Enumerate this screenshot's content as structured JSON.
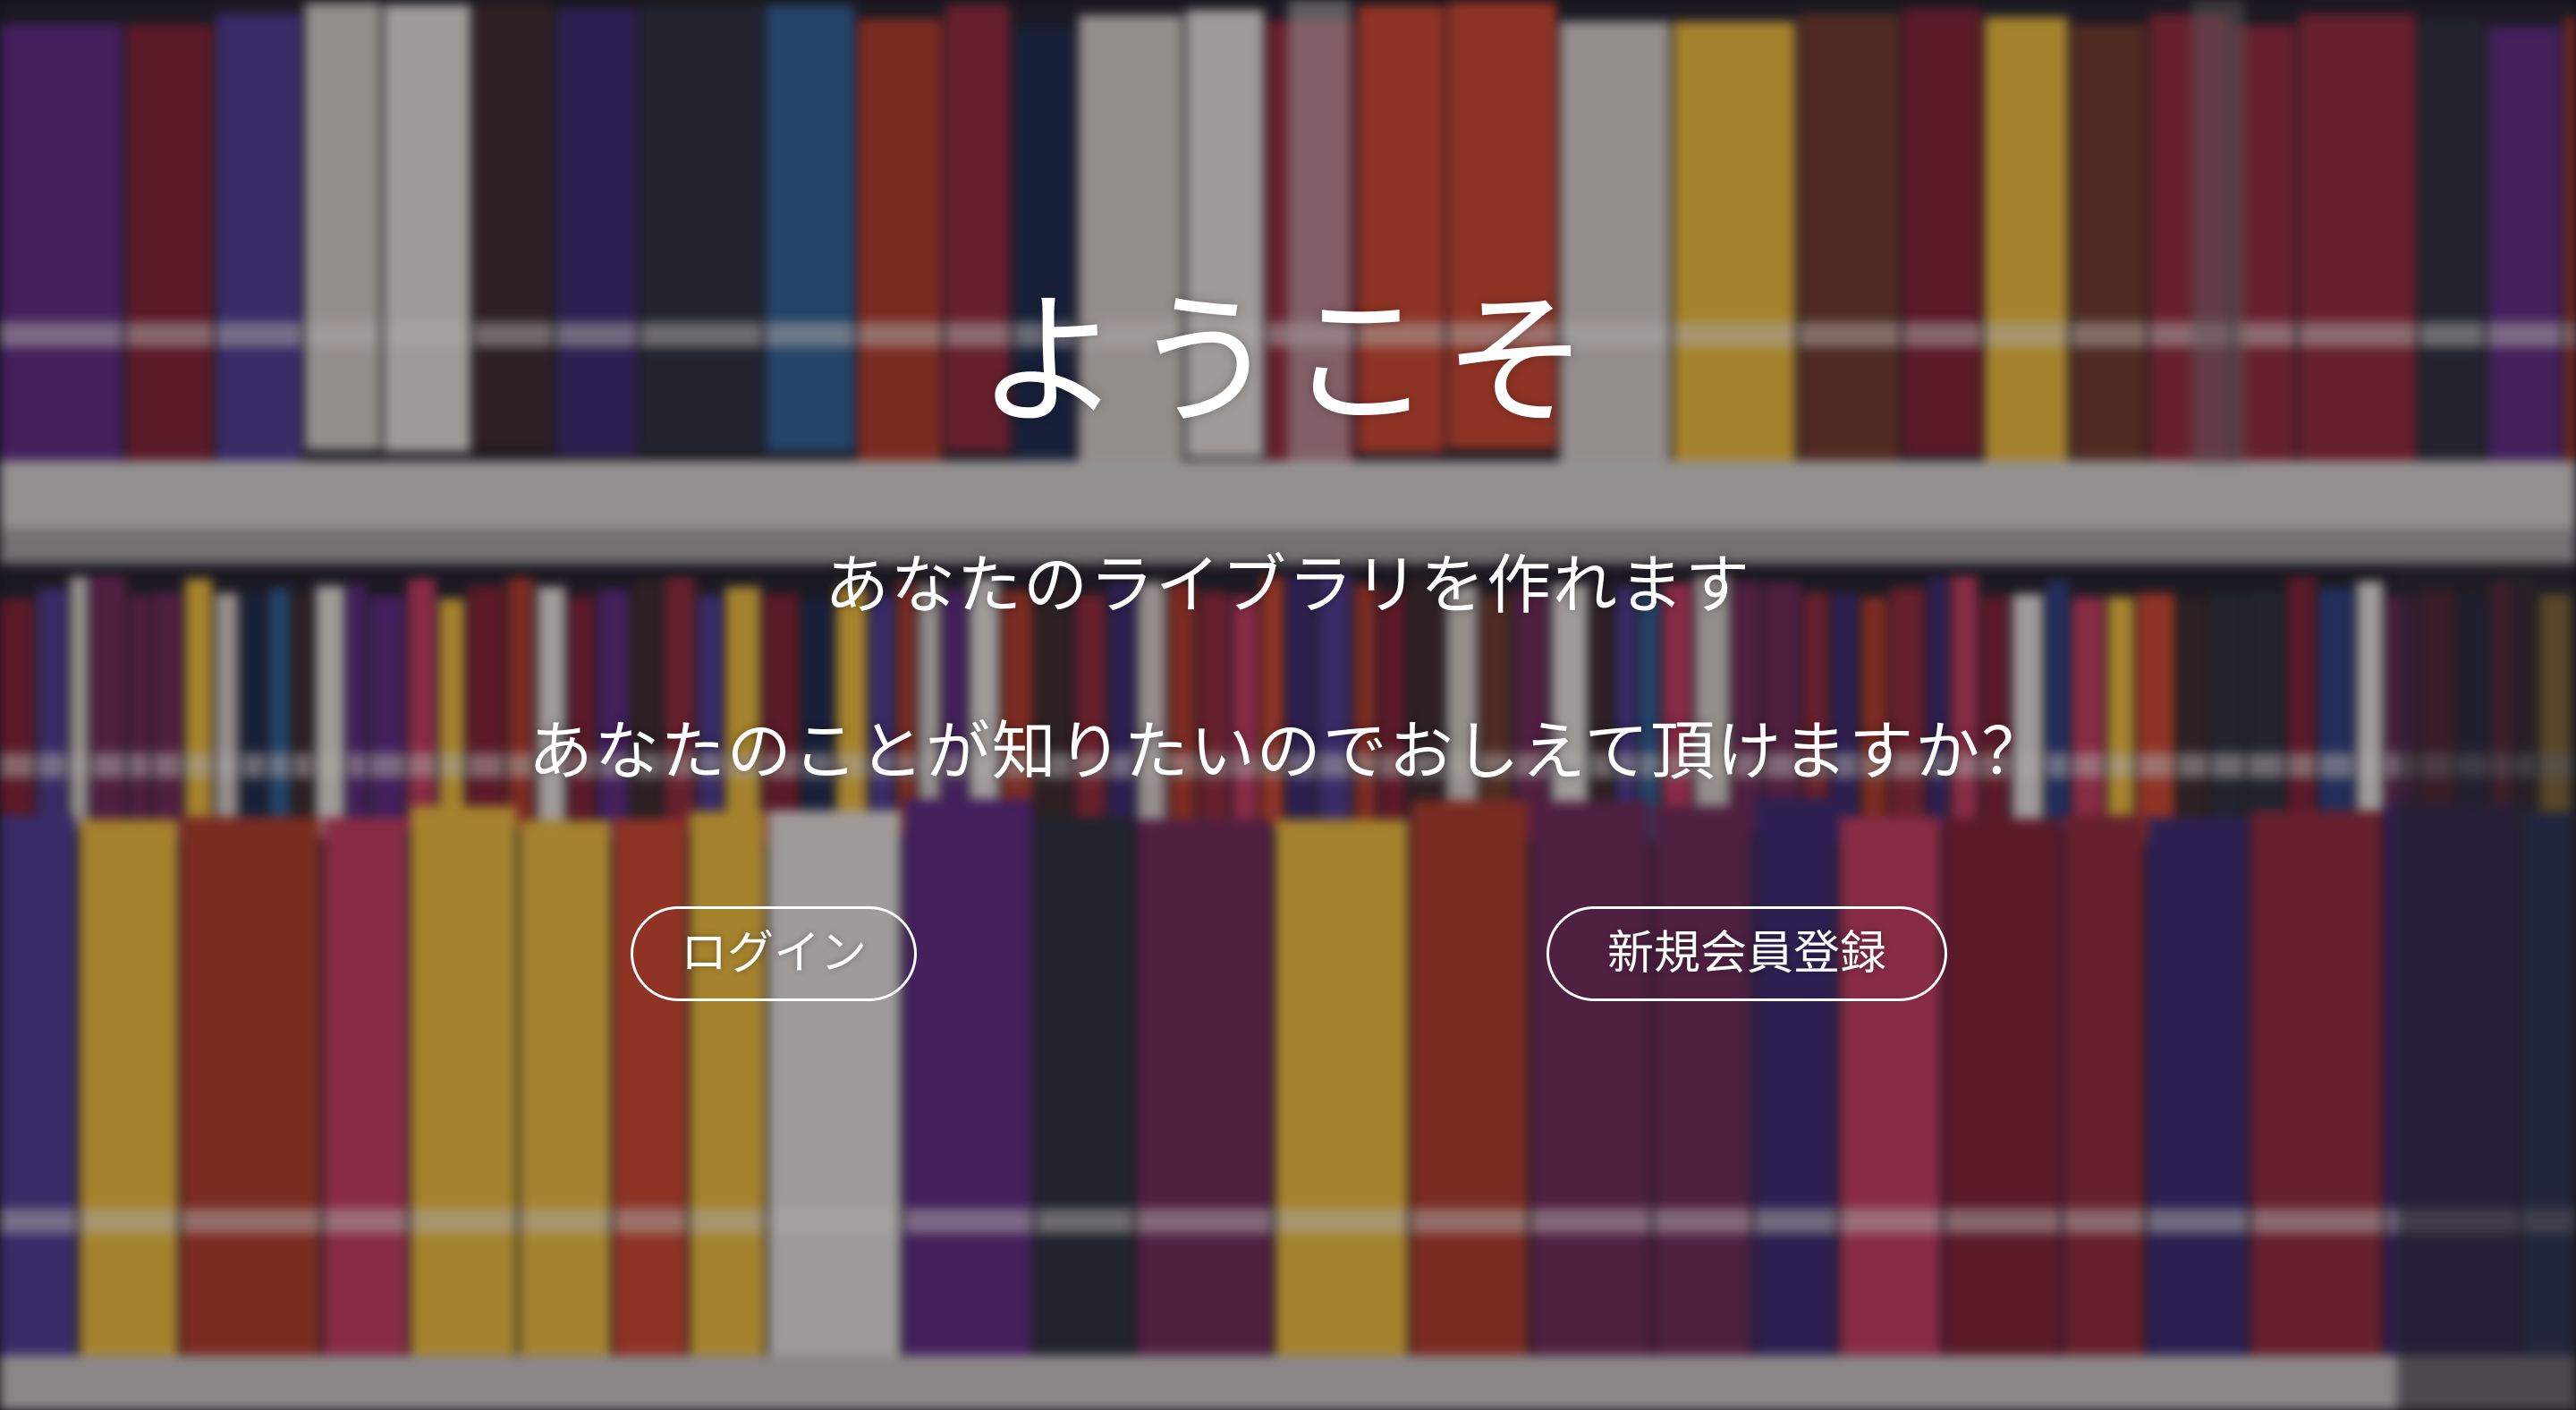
{
  "hero": {
    "title": "ようこそ",
    "subtitle_1": "あなたのライブラリを作れます",
    "subtitle_2": "あなたのことが知りたいのでおしえて頂けますか？",
    "background": "blurred-bookshelf-image"
  },
  "actions": {
    "login_label": "ログイン",
    "signup_label": "新規会員登録"
  },
  "colors": {
    "text": "#ffffff",
    "button_border": "#ffffff"
  }
}
